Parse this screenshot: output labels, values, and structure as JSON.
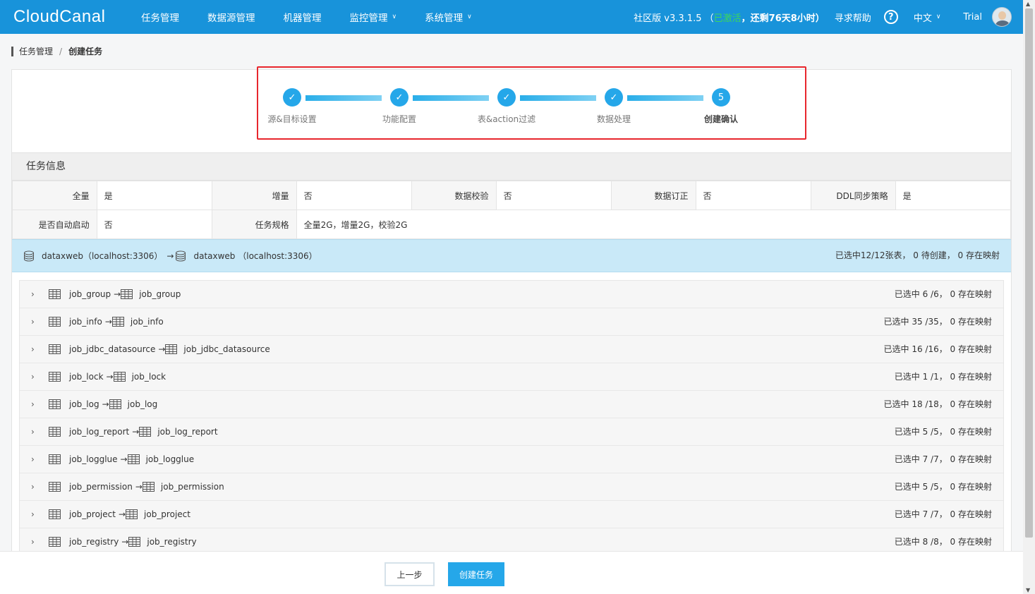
{
  "app": {
    "logo": "CloudCanal",
    "nav": [
      {
        "label": "任务管理",
        "dropdown": false
      },
      {
        "label": "数据源管理",
        "dropdown": false
      },
      {
        "label": "机器管理",
        "dropdown": false
      },
      {
        "label": "监控管理",
        "dropdown": true
      },
      {
        "label": "系统管理",
        "dropdown": true
      }
    ],
    "version_prefix": "社区版 v3.3.1.5",
    "version_open": "（",
    "activated": "已激活",
    "version_remaining": "，还剩76天8小时）",
    "help": "寻求帮助",
    "help_icon": "?",
    "lang": "中文",
    "user": "Trial",
    "colors": {
      "primary": "#1893da",
      "accent": "#25a7e9",
      "highlight": "#e8262d",
      "activated": "#3dd65a"
    }
  },
  "breadcrumb": {
    "parent": "任务管理",
    "sep": "/",
    "current": "创建任务"
  },
  "steps": [
    {
      "label": "源&目标设置",
      "done": true,
      "number": ""
    },
    {
      "label": "功能配置",
      "done": true,
      "number": ""
    },
    {
      "label": "表&action过滤",
      "done": true,
      "number": ""
    },
    {
      "label": "数据处理",
      "done": true,
      "number": ""
    },
    {
      "label": "创建确认",
      "done": false,
      "number": "5"
    }
  ],
  "task_info": {
    "title": "任务信息",
    "row1": [
      {
        "k": "全量",
        "v": "是"
      },
      {
        "k": "增量",
        "v": "否"
      },
      {
        "k": "数据校验",
        "v": "否"
      },
      {
        "k": "数据订正",
        "v": "否"
      },
      {
        "k": "DDL同步策略",
        "v": "是"
      }
    ],
    "row2": [
      {
        "k": "是否自动启动",
        "v": "否"
      },
      {
        "k": "任务规格",
        "v": "全量2G，增量2G，校验2G"
      }
    ]
  },
  "db_mapping": {
    "source": "dataxweb（localhost:3306）",
    "arrow": "→",
    "target": "dataxweb （localhost:3306）",
    "summary": "已选中12/12张表， 0 待创建， 0 存在映射"
  },
  "tables": [
    {
      "src": "job_group",
      "dst": "job_group",
      "stat": "已选中 6 /6， 0 存在映射"
    },
    {
      "src": "job_info",
      "dst": "job_info",
      "stat": "已选中 35 /35， 0 存在映射"
    },
    {
      "src": "job_jdbc_datasource",
      "dst": "job_jdbc_datasource",
      "stat": "已选中 16 /16， 0 存在映射"
    },
    {
      "src": "job_lock",
      "dst": "job_lock",
      "stat": "已选中 1 /1， 0 存在映射"
    },
    {
      "src": "job_log",
      "dst": "job_log",
      "stat": "已选中 18 /18， 0 存在映射"
    },
    {
      "src": "job_log_report",
      "dst": "job_log_report",
      "stat": "已选中 5 /5， 0 存在映射"
    },
    {
      "src": "job_logglue",
      "dst": "job_logglue",
      "stat": "已选中 7 /7， 0 存在映射"
    },
    {
      "src": "job_permission",
      "dst": "job_permission",
      "stat": "已选中 5 /5， 0 存在映射"
    },
    {
      "src": "job_project",
      "dst": "job_project",
      "stat": "已选中 7 /7， 0 存在映射"
    },
    {
      "src": "job_registry",
      "dst": "job_registry",
      "stat": "已选中 8 /8， 0 存在映射"
    }
  ],
  "footer": {
    "prev": "上一步",
    "create": "创建任务"
  }
}
